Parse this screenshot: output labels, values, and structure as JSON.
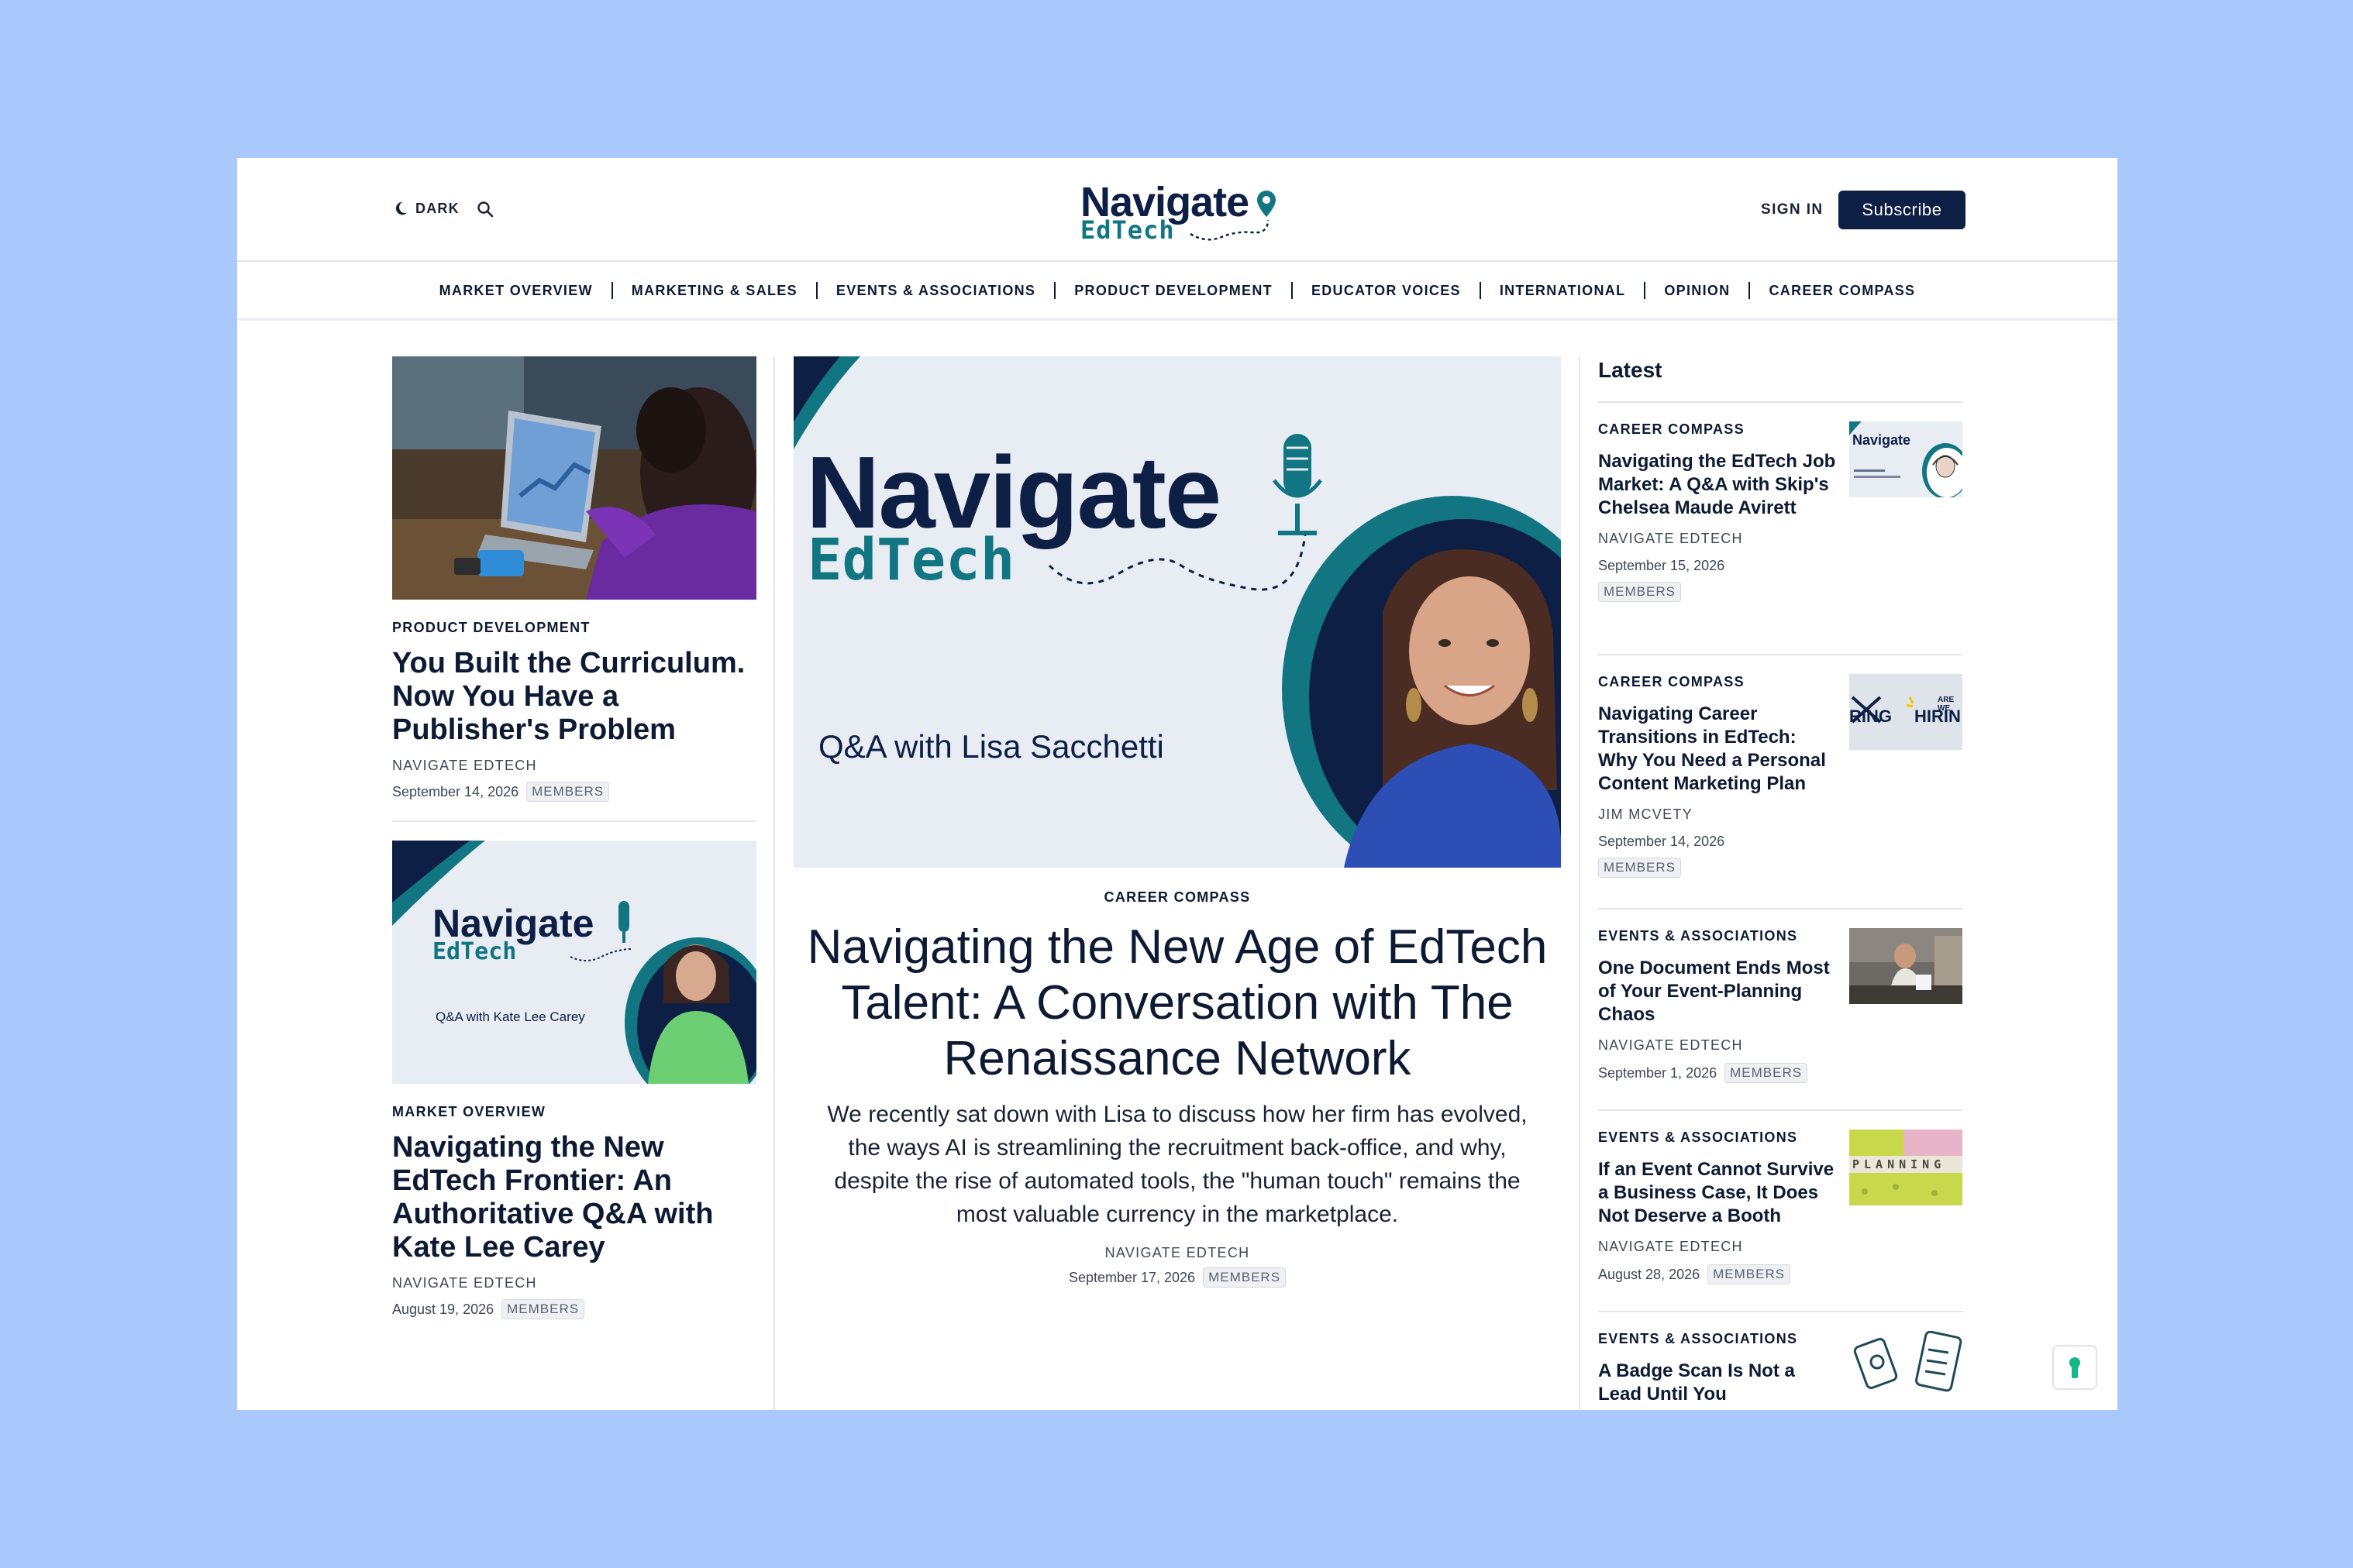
{
  "header": {
    "dark_label": "DARK",
    "logo_line1": "Navigate",
    "logo_line2": "EdTech",
    "signin_label": "SIGN IN",
    "subscribe_label": "Subscribe"
  },
  "nav": [
    {
      "label": "MARKET OVERVIEW"
    },
    {
      "label": "MARKETING & SALES"
    },
    {
      "label": "EVENTS & ASSOCIATIONS"
    },
    {
      "label": "PRODUCT DEVELOPMENT"
    },
    {
      "label": "EDUCATOR VOICES"
    },
    {
      "label": "INTERNATIONAL"
    },
    {
      "label": "OPINION"
    },
    {
      "label": "CAREER COMPASS"
    }
  ],
  "left_articles": [
    {
      "kicker": "PRODUCT DEVELOPMENT",
      "title": "You Built the Curriculum. Now You Have a Publisher's Problem",
      "author": "NAVIGATE EDTECH",
      "date": "September 14, 2026",
      "badge": "MEMBERS"
    },
    {
      "image_text_line1": "Navigate",
      "image_text_line2": "EdTech",
      "image_caption": "Q&A with Kate Lee Carey",
      "kicker": "MARKET OVERVIEW",
      "title": "Navigating the New EdTech Frontier: An Authoritative Q&A with Kate Lee Carey",
      "author": "NAVIGATE EDTECH",
      "date": "August 19, 2026",
      "badge": "MEMBERS"
    }
  ],
  "featured": {
    "image_text_line1": "Navigate",
    "image_text_line2": "EdTech",
    "image_caption": "Q&A with Lisa Sacchetti",
    "kicker": "CAREER COMPASS",
    "title": "Navigating the New Age of EdTech Talent: A Conversation with The Renaissance Network",
    "excerpt": "We recently sat down with Lisa to discuss how her firm has evolved, the ways AI is streamlining the recruitment back-office, and why, despite the rise of automated tools, the \"human touch\" remains the most valuable currency in the marketplace.",
    "author": "NAVIGATE EDTECH",
    "date": "September 17, 2026",
    "badge": "MEMBERS"
  },
  "latest": {
    "heading": "Latest",
    "items": [
      {
        "kicker": "CAREER COMPASS",
        "title": "Navigating the EdTech Job Market: A Q&A with Skip's Chelsea Maude Avirett",
        "author": "NAVIGATE EDTECH",
        "date": "September 15, 2026",
        "badge": "MEMBERS",
        "thumb_text": "Navigate"
      },
      {
        "kicker": "CAREER COMPASS",
        "title": "Navigating Career Transitions in EdTech: Why You Need a Personal Content Marketing Plan",
        "author": "JIM MCVETY",
        "date": "September 14, 2026",
        "badge": "MEMBERS",
        "thumb_text_left": "RING",
        "thumb_text_right": "HIRIN",
        "thumb_small": "ARE WE"
      },
      {
        "kicker": "EVENTS & ASSOCIATIONS",
        "title": "One Document Ends Most of Your Event-Planning Chaos",
        "author": "NAVIGATE EDTECH",
        "date": "September 1, 2026",
        "badge": "MEMBERS"
      },
      {
        "kicker": "EVENTS & ASSOCIATIONS",
        "title": "If an Event Cannot Survive a Business Case, It Does Not Deserve a Booth",
        "author": "NAVIGATE EDTECH",
        "date": "August 28, 2026",
        "badge": "MEMBERS",
        "thumb_text": "PLANNING"
      },
      {
        "kicker": "EVENTS & ASSOCIATIONS",
        "title": "A Badge Scan Is Not a Lead Until You"
      }
    ]
  },
  "colors": {
    "page_bg": "#a9c8fb",
    "navy": "#0d1f45",
    "teal": "#127582"
  }
}
